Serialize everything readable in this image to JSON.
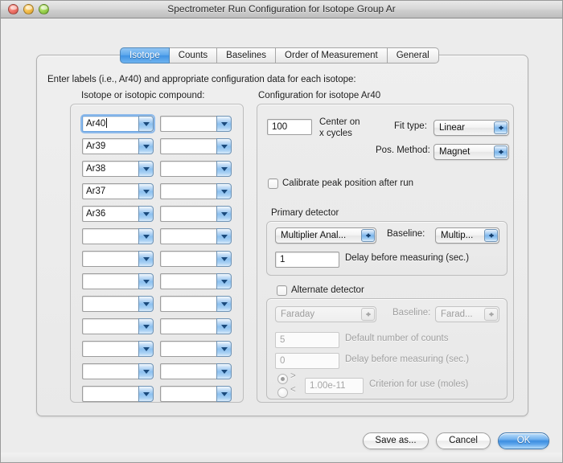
{
  "window": {
    "title": "Spectrometer Run Configuration for Isotope Group Ar",
    "close_tooltip": "Close",
    "minimize_tooltip": "Minimize",
    "zoom_tooltip": "Zoom"
  },
  "tabs": [
    {
      "label": "Isotope",
      "selected": true
    },
    {
      "label": "Counts",
      "selected": false
    },
    {
      "label": "Baselines",
      "selected": false
    },
    {
      "label": "Order of Measurement",
      "selected": false
    },
    {
      "label": "General",
      "selected": false
    }
  ],
  "intro_text": "Enter labels (i.e., Ar40) and appropriate configuration data for each isotope:",
  "left_panel": {
    "title": "Isotope or isotopic compound:",
    "column_a": [
      "Ar40",
      "Ar39",
      "Ar38",
      "Ar37",
      "Ar36",
      "",
      "",
      "",
      "",
      "",
      "",
      "",
      ""
    ],
    "column_b": [
      "",
      "",
      "",
      "",
      "",
      "",
      "",
      "",
      "",
      "",
      "",
      "",
      ""
    ],
    "focused_index": 0
  },
  "right_panel": {
    "title": "Configuration for isotope Ar40",
    "center_cycles_value": "100",
    "center_cycles_label_line1": "Center on",
    "center_cycles_label_line2": "x cycles",
    "fit_type_label": "Fit type:",
    "fit_type_value": "Linear",
    "pos_method_label": "Pos. Method:",
    "pos_method_value": "Magnet",
    "calibrate_label": "Calibrate peak position after run",
    "calibrate_checked": false,
    "primary": {
      "group_title": "Primary detector",
      "detector_value": "Multiplier Anal...",
      "baseline_label": "Baseline:",
      "baseline_value": "Multip...",
      "delay_value": "1",
      "delay_label": "Delay before measuring (sec.)"
    },
    "alternate": {
      "checkbox_label": "Alternate detector",
      "checked": false,
      "detector_value": "Faraday",
      "baseline_label": "Baseline:",
      "baseline_value": "Farad...",
      "counts_value": "5",
      "counts_label": "Default number of counts",
      "delay_value": "0",
      "delay_label": "Delay before measuring (sec.)",
      "gt_symbol": ">",
      "lt_symbol": "<",
      "criterion_value": "1.00e-11",
      "criterion_label": "Criterion for use (moles)",
      "gt_selected": true
    }
  },
  "buttons": {
    "save_as": "Save as...",
    "cancel": "Cancel",
    "ok": "OK"
  },
  "colors": {
    "accent_blue": "#3d8ee0",
    "selected_tab": "#5ba7ec",
    "window_bg": "#ececec"
  }
}
